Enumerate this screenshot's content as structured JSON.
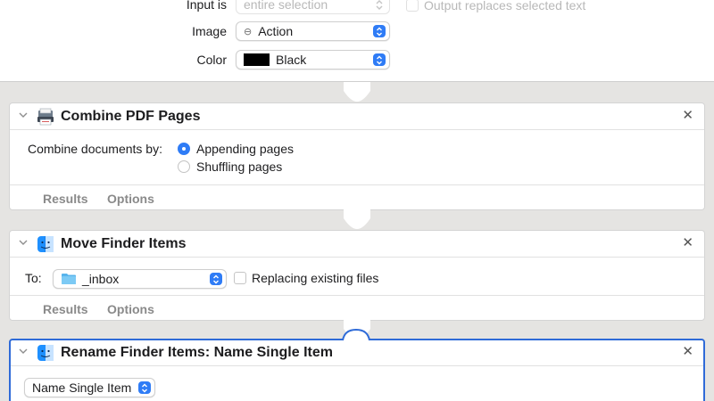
{
  "top_panel": {
    "input_label": "Input is",
    "input_value": "entire selection",
    "output_checkbox_label": "Output replaces selected text",
    "image_label": "Image",
    "image_value": "Action",
    "color_label": "Color",
    "color_value": "Black",
    "color_swatch": "#000000"
  },
  "combine_pdf": {
    "title": "Combine PDF Pages",
    "combine_label": "Combine documents by:",
    "options": [
      "Appending pages",
      "Shuffling pages"
    ],
    "selected_option": "Appending pages",
    "tabs": [
      "Results",
      "Options"
    ]
  },
  "move_finder": {
    "title": "Move Finder Items",
    "to_label": "To:",
    "destination": "_inbox",
    "replace_label": "Replacing existing files",
    "tabs": [
      "Results",
      "Options"
    ]
  },
  "rename_finder": {
    "title": "Rename Finder Items: Name Single Item",
    "mode_value": "Name Single Item"
  },
  "colors": {
    "accent": "#2f7cf6",
    "selection_border": "#2f6bd8",
    "background": "#e5e4e2"
  },
  "icons": [
    "minus-circle-icon",
    "pdf-combine-icon",
    "finder-icon",
    "folder-icon",
    "close-icon",
    "chevron-down-icon",
    "stepper-icon"
  ]
}
